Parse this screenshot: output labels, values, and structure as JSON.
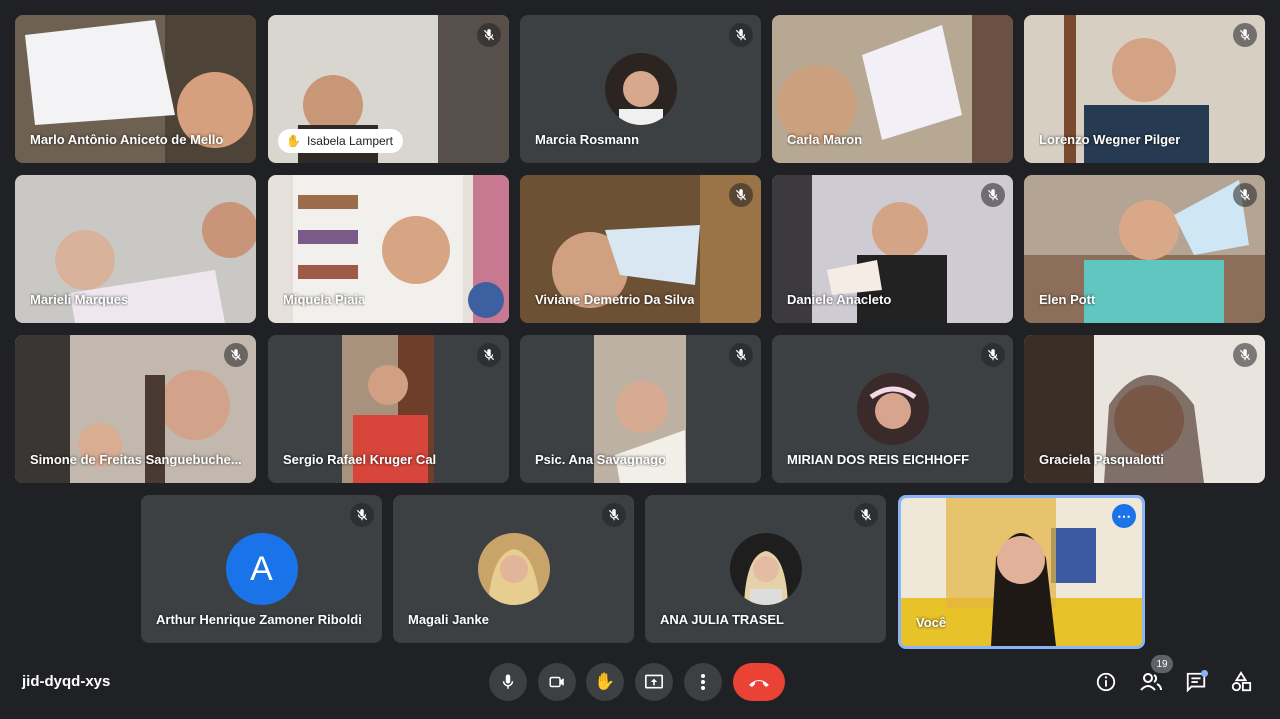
{
  "meeting": {
    "code": "jid-dyqd-xys"
  },
  "participants": [
    {
      "name": "Marlo Antônio Aniceto de Mello",
      "kind": "video",
      "muted": false
    },
    {
      "name": "Isabela Lampert",
      "kind": "video",
      "muted": true,
      "hand_raised": true
    },
    {
      "name": "Marcia Rosmann",
      "kind": "avatar",
      "muted": true
    },
    {
      "name": "Carla Maron",
      "kind": "video",
      "muted": false
    },
    {
      "name": "Lorenzo Wegner Pilger",
      "kind": "video",
      "muted": true
    },
    {
      "name": "Marieli Marques",
      "kind": "video",
      "muted": false
    },
    {
      "name": "Miquela Piaia",
      "kind": "video",
      "muted": false
    },
    {
      "name": "Viviane Demetrio Da Silva",
      "kind": "video",
      "muted": true
    },
    {
      "name": "Daniele Anacleto",
      "kind": "video",
      "muted": true
    },
    {
      "name": "Elen Pott",
      "kind": "video",
      "muted": true
    },
    {
      "name": "Simone de Freitas Sanguebuche...",
      "kind": "video",
      "muted": true
    },
    {
      "name": "Sergio Rafael Kruger Cal",
      "kind": "video",
      "muted": true
    },
    {
      "name": "Psic. Ana Savagnago",
      "kind": "video",
      "muted": true
    },
    {
      "name": "MIRIAN DOS REIS EICHHOFF",
      "kind": "avatar",
      "muted": true
    },
    {
      "name": "Graciela Pasqualotti",
      "kind": "video",
      "muted": true
    },
    {
      "name": "Arthur Henrique Zamoner Riboldi",
      "kind": "letter",
      "letter": "A",
      "muted": true
    },
    {
      "name": "Magali Janke",
      "kind": "avatar",
      "muted": true
    },
    {
      "name": "ANA JULIA TRASEL",
      "kind": "avatar",
      "muted": true
    },
    {
      "name": "Você",
      "kind": "video",
      "muted": false,
      "self": true
    }
  ],
  "toolbar": {
    "buttons": [
      "microphone",
      "camera",
      "raise-hand",
      "present-screen",
      "more-options",
      "leave-call"
    ]
  },
  "right_controls": {
    "participants_count": "19",
    "buttons": [
      "meeting-details",
      "people",
      "chat",
      "activities"
    ]
  },
  "colors": {
    "background": "#202124",
    "tile": "#3c4043",
    "hangup": "#ea4335",
    "accent": "#1a73e8",
    "self_border": "#8ab4f8"
  }
}
